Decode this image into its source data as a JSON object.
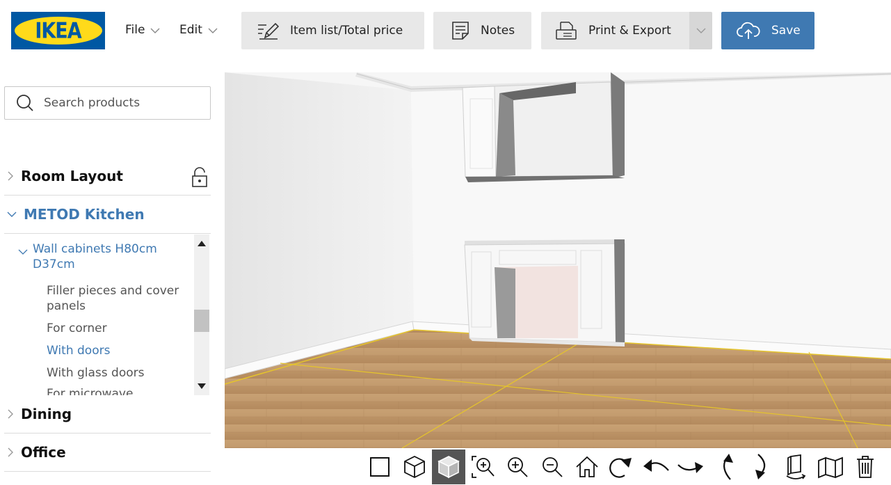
{
  "app": {
    "logo_text": "IKEA"
  },
  "menu": {
    "file": "File",
    "edit": "Edit"
  },
  "toolbar": {
    "item_list_label": "Item list/Total price",
    "notes_label": "Notes",
    "print_label": "Print & Export",
    "save_label": "Save"
  },
  "search": {
    "placeholder": "Search products"
  },
  "sidebar": {
    "categories": [
      {
        "label": "Room Layout",
        "icon": "unlock-icon"
      },
      {
        "label": "METOD Kitchen"
      },
      {
        "label": "Dining"
      },
      {
        "label": "Office"
      }
    ],
    "subcategory": {
      "label": "Wall cabinets H80cm D37cm",
      "items": [
        {
          "label": "Filler pieces and cover panels"
        },
        {
          "label": "For corner"
        },
        {
          "label": "With doors"
        },
        {
          "label": "With glass doors"
        },
        {
          "label": "For microwave"
        }
      ]
    }
  },
  "colors": {
    "brand_blue": "#0058a3",
    "brand_yellow": "#ffda1a",
    "accent": "#3f79b2",
    "save_button": "#3f79b2"
  },
  "tools": [
    "2d-view-icon",
    "3d-wireframe-icon",
    "3d-view-icon",
    "zoom-area-icon",
    "zoom-in-icon",
    "zoom-out-icon",
    "home-view-icon",
    "rotate-icon",
    "pan-left-icon",
    "pan-right-icon",
    "tilt-up-icon",
    "tilt-down-icon",
    "wall-visibility-icon",
    "walls-icon",
    "delete-icon"
  ]
}
